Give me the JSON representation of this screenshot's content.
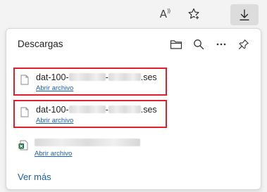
{
  "toolbar": {
    "read_aloud_icon": "read-aloud-icon",
    "read_aloud_text": "A",
    "favorites_icon": "add-favorite-icon",
    "downloads_icon": "download-arrow-icon"
  },
  "panel": {
    "title": "Descargas",
    "actions": [
      {
        "name": "open-folder-icon"
      },
      {
        "name": "search-icon"
      },
      {
        "name": "more-options-icon"
      },
      {
        "name": "pin-icon"
      }
    ],
    "items": [
      {
        "name_prefix": "dat-100-",
        "name_sep": "-",
        "name_suffix": ".ses",
        "open_label": "Abrir archivo",
        "icon": "generic-file-icon",
        "highlighted": true
      },
      {
        "name_prefix": "dat-100-",
        "name_sep": "-",
        "name_suffix": ".ses",
        "open_label": "Abrir archivo",
        "icon": "generic-file-icon",
        "highlighted": true
      },
      {
        "name_prefix": "",
        "name_sep": "",
        "name_suffix": "",
        "open_label": "Abrir archivo",
        "icon": "excel-file-icon",
        "highlighted": false
      }
    ],
    "see_more": "Ver más"
  },
  "colors": {
    "highlight": "#e0202c",
    "link": "#1a5fb4",
    "excel": "#1d6f42"
  }
}
